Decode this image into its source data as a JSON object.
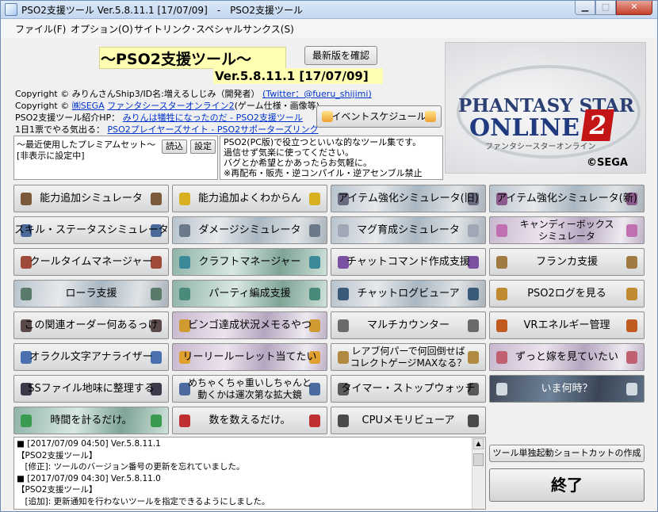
{
  "window": {
    "title": "PSO2支援ツール Ver.5.8.11.1 [17/07/09]　-　PSO2支援ツール"
  },
  "menu": {
    "file": "ファイル(F)",
    "option": "オプション(O)",
    "site": "サイトリンク･スペシャルサンクス(S)"
  },
  "header": {
    "main_title": "～PSO2支援ツール～",
    "check_update": "最新版を確認",
    "version": "Ver.5.8.11.1 [17/07/09]"
  },
  "credits": {
    "line1_prefix": "Copyright © みりんさんShip3/ID名:増えるしじみ（開発者）",
    "line1_link": "(Twitter：@fueru_shijimi)",
    "line2_prefix": "Copyright © ",
    "line2_link1": "㈱SEGA",
    "line2_link2": "ファンタシースターオンライン2",
    "line2_suffix": "(ゲーム仕様・画像等)",
    "line3_prefix": "PSO2支援ツール紹介HP：",
    "line3_link": "みりんは犠牲になったのだ - PSO2支援ツール",
    "line4_prefix": "1日1票でやる気出る：",
    "line4_link": "PSO2プレイヤーズサイト - PSO2サポーターズリンク"
  },
  "event_schedule": "イベントスケジュール",
  "preset": {
    "title": "～最近使用したプレミアムセット～",
    "status": "[非表示に設定中]",
    "load": "読込",
    "settings": "設定"
  },
  "description": [
    "PSO2(PC版)で役立つといいな的なツール集です。",
    "過信せず気楽に使ってください。",
    "バグとか希望とかあったらお気軽に。",
    "※再配布・販売・逆コンパイル・逆アセンブル禁止"
  ],
  "logo": {
    "line1": "PHANTASY STAR",
    "line2": "ONLINE",
    "mark": "2",
    "sub": "ファンタシースターオンライン",
    "sega": "©SEGA"
  },
  "tools": [
    {
      "label": "能力追加シミュレータ",
      "style": "plain",
      "icon": "#7a5a3a"
    },
    {
      "label": "能力追加よくわからん",
      "style": "plain",
      "icon": "#d6b020"
    },
    {
      "label": "アイテム強化シミュレータ(旧)",
      "style": "scene",
      "icon": "#6a6a80"
    },
    {
      "label": "アイテム強化シミュレータ(新)",
      "style": "scene",
      "icon": "#8a5a8a"
    },
    {
      "label": "スキル・ステータスシミュレータ",
      "style": "plain",
      "icon": "#4a6a9a"
    },
    {
      "label": "ダメージシミュレータ",
      "style": "scene",
      "icon": "#6a7a8a"
    },
    {
      "label": "マグ育成シミュレータ",
      "style": "scene",
      "icon": "#a0a8b8"
    },
    {
      "label": "キャンディーボックス",
      "label2": "シミュレータ",
      "style": "scene2",
      "icon": "#c070b0"
    },
    {
      "label": "クールタイムマネージャー",
      "style": "plain",
      "icon": "#a04a3a"
    },
    {
      "label": "クラフトマネージャー",
      "style": "scene3",
      "icon": "#3a8a9a"
    },
    {
      "label": "チャットコマンド作成支援",
      "style": "plain",
      "icon": "#7a50a0"
    },
    {
      "label": "フランカ支援",
      "style": "plain",
      "icon": "#a07a40"
    },
    {
      "label": "ローラ支援",
      "style": "scene",
      "icon": "#5a7a6a"
    },
    {
      "label": "パーティ編成支援",
      "style": "scene3",
      "icon": "#4a8a7a"
    },
    {
      "label": "チャットログビューア",
      "style": "scene",
      "icon": "#3a5a7a"
    },
    {
      "label": "PSO2ログを見る",
      "style": "plain",
      "icon": "#c08a30"
    },
    {
      "label": "この関連オーダー何あるっけ",
      "style": "plain",
      "icon": "#5a4a4a"
    },
    {
      "label": "ビンゴ達成状況メモるやつ",
      "style": "scene2",
      "icon": "#d09a30"
    },
    {
      "label": "マルチカウンター",
      "style": "plain",
      "icon": "#6a6a6a"
    },
    {
      "label": "VRエネルギー管理",
      "style": "plain",
      "icon": "#c05a20"
    },
    {
      "label": "オラクル文字アナライザー",
      "style": "plain",
      "icon": "#4a70b0"
    },
    {
      "label": "リーリールーレット当てたい",
      "style": "scene2",
      "icon": "#e0a030"
    },
    {
      "label": "レアブ何パーで何回倒せば",
      "label2": "コレクトゲージMAXなる？",
      "style": "plain",
      "icon": "#b08a40"
    },
    {
      "label": "ずっと嫁を見ていたい",
      "style": "scene2",
      "icon": "#c06070"
    },
    {
      "label": "SSファイル地味に整理する",
      "style": "plain",
      "icon": "#3a3a4a"
    },
    {
      "label": "めちゃくちゃ重いしちゃんと",
      "label2": "動くかは運次第な拡大鏡",
      "style": "plain",
      "icon": "#4a6aa0"
    },
    {
      "label": "タイマー・ストップウォッチ",
      "style": "plain",
      "icon": "#5a5a5a"
    },
    {
      "label": "いま何時？",
      "style": "dark",
      "icon": "#d0d8e0"
    },
    {
      "label": "時間を計るだけ。",
      "style": "scene3",
      "icon": "#3a9a50"
    },
    {
      "label": "数を数えるだけ。",
      "style": "plain",
      "icon": "#c03030"
    },
    {
      "label": "CPUメモリビューア",
      "style": "plain",
      "icon": "#4a4a4a"
    }
  ],
  "log": [
    "■ [2017/07/09 04:50] Ver.5.8.11.1",
    "【PSO2支援ツール】",
    "　[修正]: ツールのバージョン番号の更新を忘れていました。",
    "■ [2017/07/09 04:30] Ver.5.8.11.0",
    "【PSO2支援ツール】",
    "　[追加]: 更新通知を行わないツールを指定できるようにしました。"
  ],
  "footer": {
    "shortcut": "ツール単独起動ショートカットの作成",
    "exit": "終了"
  }
}
